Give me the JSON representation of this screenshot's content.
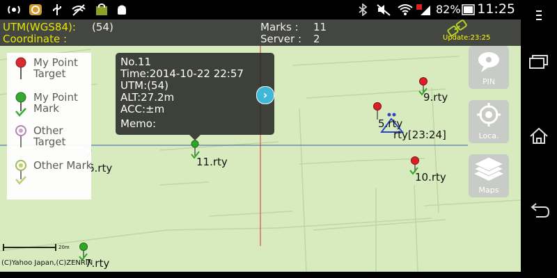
{
  "status_bar": {
    "battery": "82%",
    "time": "11:25",
    "icons": [
      "hotspot-icon",
      "app-icon",
      "usb-icon",
      "wifi-strike-icon",
      "shopping-icon",
      "android-icon",
      "bluetooth-icon",
      "mute-icon",
      "wifi-icon",
      "signal-icon",
      "battery-icon"
    ]
  },
  "header": {
    "utm_label": "UTM(WGS84):",
    "utm_value": "(54)",
    "coordinate_label": "Coordinate :",
    "marks_label": "Marks :",
    "marks_value": "11",
    "server_label": "Server :",
    "server_value": "2",
    "update": "Update:23:25"
  },
  "legend": [
    {
      "label": "My Point Target",
      "color": "#d8202a"
    },
    {
      "label": "My Point Mark",
      "color": "#2fa52a"
    },
    {
      "label": "Other Target",
      "color": "#c9a0cc"
    },
    {
      "label": "Other Mark",
      "color": "#b5d070"
    }
  ],
  "popup": {
    "no": "No.11",
    "time": "Time:2014-10-22 22:57",
    "utm": "UTM:(54)",
    "alt": "ALT:27.2m",
    "acc": "ACC:±m",
    "memo": "Memo:"
  },
  "markers": [
    {
      "label": "11.rty"
    },
    {
      "label": "9.rty"
    },
    {
      "label": "5.rty"
    },
    {
      "label": "rty[23:24]"
    },
    {
      "label": "10.rty"
    },
    {
      "label": "6.rty"
    },
    {
      "label": "7.rty"
    }
  ],
  "side_buttons": [
    {
      "label": "PIN"
    },
    {
      "label": "Loca."
    },
    {
      "label": "Maps"
    }
  ],
  "scale": "20m",
  "attribution": "(C)Yahoo Japan,(C)ZENRIN"
}
